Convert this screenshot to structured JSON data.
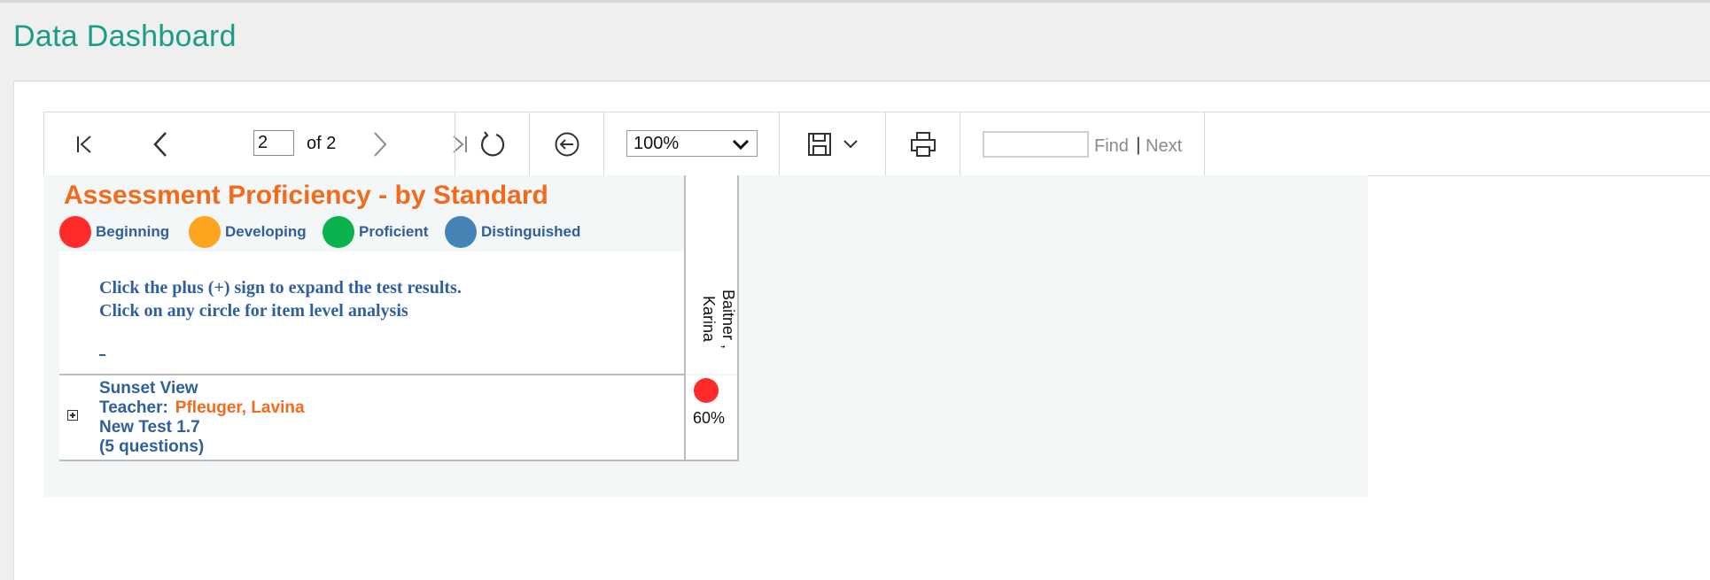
{
  "page": {
    "title": "Data Dashboard"
  },
  "toolbar": {
    "current_page": "2",
    "page_total_label": "of 2",
    "zoom": "100%",
    "find_placeholder": "",
    "find_label": "Find",
    "find_separator": "|",
    "next_label": "Next",
    "icons": [
      "first-page-icon",
      "previous-page-icon",
      "next-page-icon",
      "last-page-icon",
      "refresh-icon",
      "back-icon",
      "save-icon",
      "chevron-down-icon",
      "print-icon"
    ]
  },
  "report": {
    "title": "Assessment Proficiency - by Standard",
    "legend": [
      {
        "label": "Beginning",
        "color": "#ff2b2b"
      },
      {
        "label": "Developing",
        "color": "#ffa41e"
      },
      {
        "label": "Proficient",
        "color": "#0ab34e"
      },
      {
        "label": "Distinguished",
        "color": "#4682b4"
      }
    ],
    "instructions": [
      "Click the plus (+) sign to expand the test results.",
      "Click on any circle for item level analysis"
    ],
    "student": "Baitner , Karina",
    "row": {
      "school": "Sunset View",
      "teacher_label": "Teacher:",
      "teacher": "Pfleuger, Lavina",
      "test": "New Test 1.7",
      "questions": "(5 questions)",
      "score_color": "#ff2b2b",
      "score": "60%"
    }
  }
}
